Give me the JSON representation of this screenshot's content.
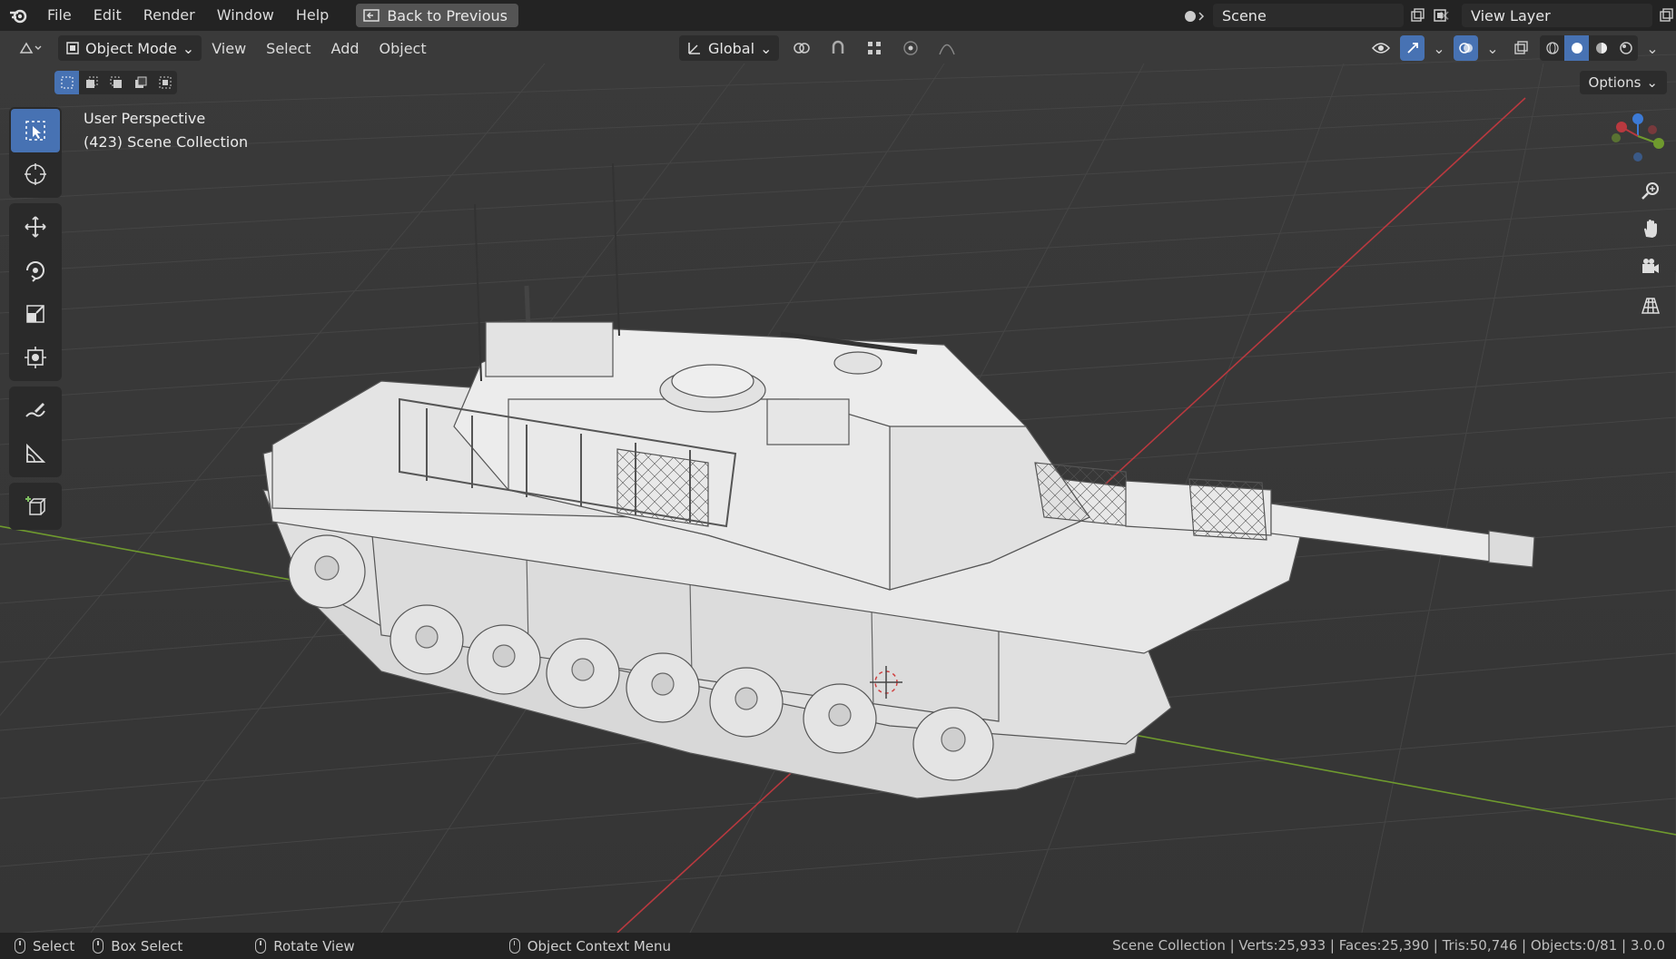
{
  "menus": [
    "File",
    "Edit",
    "Render",
    "Window",
    "Help"
  ],
  "back_button": "Back to Previous",
  "scene": {
    "label": "Scene"
  },
  "view_layer": {
    "label": "View Layer"
  },
  "header": {
    "mode": "Object Mode",
    "menus": [
      "View",
      "Select",
      "Add",
      "Object"
    ],
    "orientation": "Global",
    "options": "Options"
  },
  "viewport": {
    "perspective": "User Perspective",
    "collection": "(423) Scene Collection"
  },
  "status": {
    "select": "Select",
    "box_select": "Box Select",
    "rotate_view": "Rotate View",
    "context_menu": "Object Context Menu",
    "stats": "Scene Collection | Verts:25,933 | Faces:25,390 | Tris:50,746 | Objects:0/81 | 3.0.0"
  },
  "colors": {
    "accent": "#4772b3",
    "x_axis": "#b8393f",
    "y_axis": "#6f9a2e",
    "model": "#e6e6e6"
  }
}
